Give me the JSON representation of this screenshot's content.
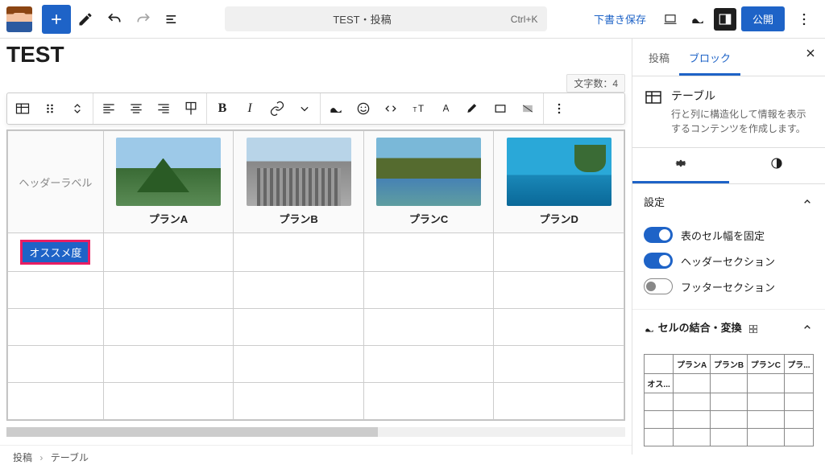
{
  "topbar": {
    "doc_title": "TEST・投稿",
    "shortcut": "Ctrl+K",
    "save_draft": "下書き保存",
    "publish": "公開"
  },
  "editor": {
    "page_title": "TEST",
    "char_count_label": "文字数：4",
    "table": {
      "header_label": "ヘッダーラベル",
      "plans": [
        "プランA",
        "プランB",
        "プランC",
        "プランD"
      ],
      "row1_label": "オススメ度"
    }
  },
  "sidebar": {
    "tabs": {
      "post": "投稿",
      "block": "ブロック"
    },
    "block_info": {
      "title": "テーブル",
      "desc": "行と列に構造化して情報を表示するコンテンツを作成します。"
    },
    "settings": {
      "title": "設定",
      "fixed_width": "表のセル幅を固定",
      "header_section": "ヘッダーセクション",
      "footer_section": "フッターセクション"
    },
    "merge": {
      "title": "セルの結合・変換",
      "cols": [
        "プランA",
        "プランB",
        "プランC",
        "プラ..."
      ],
      "row1": "オス..."
    }
  },
  "breadcrumb": {
    "item1": "投稿",
    "item2": "テーブル"
  },
  "icons": {
    "gear": "gear-icon",
    "contrast": "contrast-icon",
    "close": "close-icon"
  }
}
